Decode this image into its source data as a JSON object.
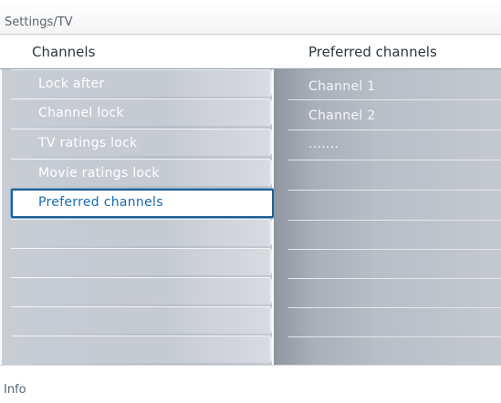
{
  "breadcrumb": "Settings/TV",
  "left_column": {
    "title": "Channels",
    "items": [
      {
        "label": "Lock after"
      },
      {
        "label": "Channel lock"
      },
      {
        "label": "TV ratings lock"
      },
      {
        "label": "Movie ratings lock"
      },
      {
        "label": "Preferred channels",
        "selected": true
      },
      {
        "label": ""
      },
      {
        "label": ""
      },
      {
        "label": ""
      },
      {
        "label": ""
      },
      {
        "label": ""
      }
    ]
  },
  "right_column": {
    "title": "Preferred channels",
    "items": [
      "Channel 1",
      "Channel 2",
      "......."
    ]
  },
  "info_bar": {
    "label": "Info"
  },
  "colors": {
    "selection_border": "#1e5f95",
    "selected_text": "#1a6ab0",
    "menu_text": "#ffffff"
  }
}
